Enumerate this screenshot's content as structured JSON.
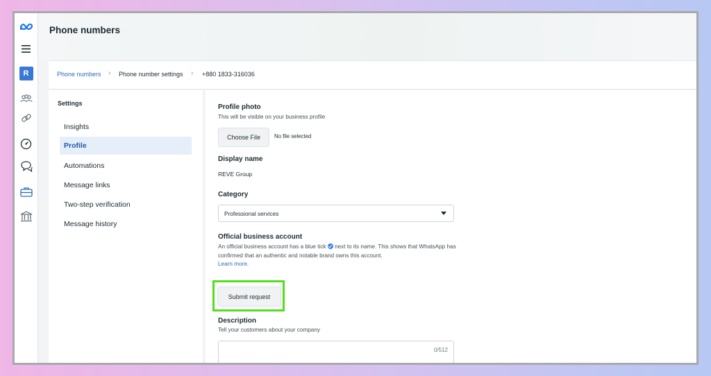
{
  "header": {
    "title": "Phone numbers"
  },
  "breadcrumb": [
    {
      "label": "Phone numbers"
    },
    {
      "label": "Phone number settings"
    },
    {
      "label": "+880 1833-316036"
    }
  ],
  "rail": {
    "avatar_letter": "R"
  },
  "settings": {
    "heading": "Settings",
    "items": [
      {
        "label": "Insights"
      },
      {
        "label": "Profile"
      },
      {
        "label": "Automations"
      },
      {
        "label": "Message links"
      },
      {
        "label": "Two-step verification"
      },
      {
        "label": "Message history"
      }
    ]
  },
  "profile": {
    "photo": {
      "title": "Profile photo",
      "subtitle": "This will be visible on your business profile",
      "choose_file": "Choose File",
      "no_file": "No file selected"
    },
    "display_name": {
      "title": "Display name",
      "value": "REVE Group"
    },
    "category": {
      "title": "Category",
      "value": "Professional services"
    },
    "official": {
      "title": "Official business account",
      "text_before": "An official business account has a blue tick",
      "text_after": "next to its name. This shows that WhatsApp has confirmed that an authentic and notable brand owns this account.",
      "learn_more": "Learn more.",
      "submit": "Submit request"
    },
    "description": {
      "title": "Description",
      "subtitle": "Tell your customers about your company",
      "counter": "0/512"
    }
  },
  "colors": {
    "accent": "#1c5aa6",
    "highlight": "#4fe01a",
    "verified": "#2f80ed"
  }
}
